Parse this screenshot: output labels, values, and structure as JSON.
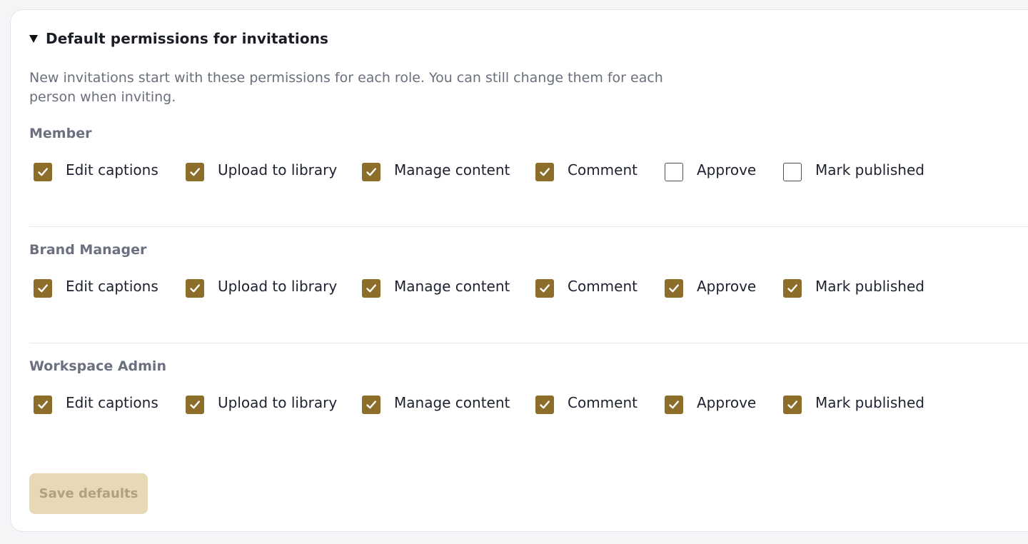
{
  "section": {
    "title": "Default permissions for invitations",
    "description": "New invitations start with these permissions for each role. You can still change them for each person when inviting."
  },
  "roles": [
    {
      "name": "Member",
      "permissions": [
        {
          "label": "Edit captions",
          "checked": true
        },
        {
          "label": "Upload to library",
          "checked": true
        },
        {
          "label": "Manage content",
          "checked": true
        },
        {
          "label": "Comment",
          "checked": true
        },
        {
          "label": "Approve",
          "checked": false
        },
        {
          "label": "Mark published",
          "checked": false
        }
      ]
    },
    {
      "name": "Brand Manager",
      "permissions": [
        {
          "label": "Edit captions",
          "checked": true
        },
        {
          "label": "Upload to library",
          "checked": true
        },
        {
          "label": "Manage content",
          "checked": true
        },
        {
          "label": "Comment",
          "checked": true
        },
        {
          "label": "Approve",
          "checked": true
        },
        {
          "label": "Mark published",
          "checked": true
        }
      ]
    },
    {
      "name": "Workspace Admin",
      "permissions": [
        {
          "label": "Edit captions",
          "checked": true
        },
        {
          "label": "Upload to library",
          "checked": true
        },
        {
          "label": "Manage content",
          "checked": true
        },
        {
          "label": "Comment",
          "checked": true
        },
        {
          "label": "Approve",
          "checked": true
        },
        {
          "label": "Mark published",
          "checked": true
        }
      ]
    }
  ],
  "actions": {
    "save_label": "Save defaults",
    "save_disabled": true
  },
  "colors": {
    "accent": "#8c6d2a",
    "button_disabled_bg": "#e7d9b5",
    "button_disabled_text": "#b0a27f"
  },
  "icons": {
    "caret": "caret-down-icon",
    "check": "checkmark-icon"
  }
}
